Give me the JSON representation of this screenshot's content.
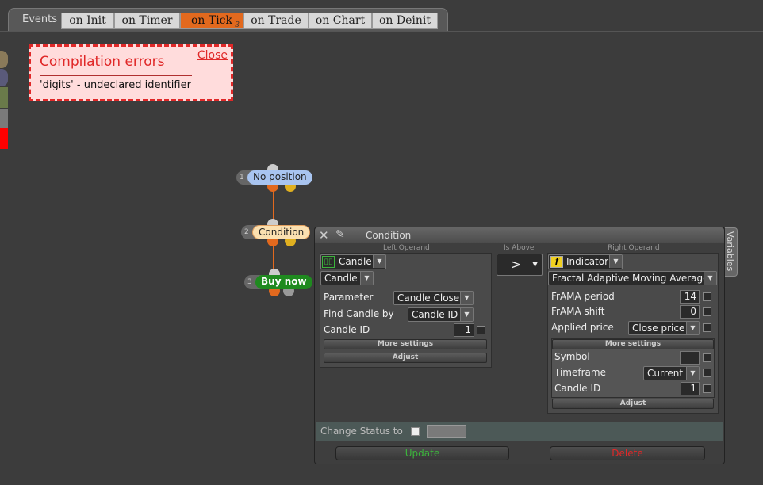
{
  "tabs": {
    "events_label": "Events",
    "items": [
      "on Init",
      "on Timer",
      "on Tick",
      "on Trade",
      "on Chart",
      "on Deinit"
    ],
    "active": "on Tick",
    "active_badge": "3"
  },
  "error": {
    "title": "Compilation errors",
    "close_label": "Close",
    "message": "'digits' - undeclared identifier"
  },
  "flow": {
    "nodes": [
      {
        "num": "1",
        "label": "No position"
      },
      {
        "num": "2",
        "label": "Condition"
      },
      {
        "num": "3",
        "label": "Buy now"
      }
    ]
  },
  "panel": {
    "title": "Condition",
    "variables_tab": "Variables",
    "left_operand_label": "Left Operand",
    "operator_label": "Is Above",
    "right_operand_label": "Right Operand",
    "operator_value": ">",
    "left": {
      "type": "Candle",
      "subtype": "Candle",
      "parameter_label": "Parameter",
      "parameter_value": "Candle Close",
      "find_label": "Find Candle by",
      "find_value": "Candle ID",
      "id_label": "Candle ID",
      "id_value": "1",
      "more_settings": "More settings",
      "adjust": "Adjust"
    },
    "right": {
      "type": "Indicator",
      "indicator": "Fractal Adaptive Moving Average",
      "period_label": "FrAMA period",
      "period_value": "14",
      "shift_label": "FrAMA shift",
      "shift_value": "0",
      "price_label": "Applied price",
      "price_value": "Close price",
      "more_settings": "More settings",
      "symbol_label": "Symbol",
      "symbol_value": "",
      "timeframe_label": "Timeframe",
      "timeframe_value": "Current",
      "id_label": "Candle ID",
      "id_value": "1",
      "adjust": "Adjust"
    },
    "change_status_label": "Change Status to",
    "update_label": "Update",
    "delete_label": "Delete"
  },
  "colors": {
    "accent": "#e2691e",
    "error": "#e02828",
    "update_text": "#3cb43c",
    "delete_text": "#e02828"
  }
}
